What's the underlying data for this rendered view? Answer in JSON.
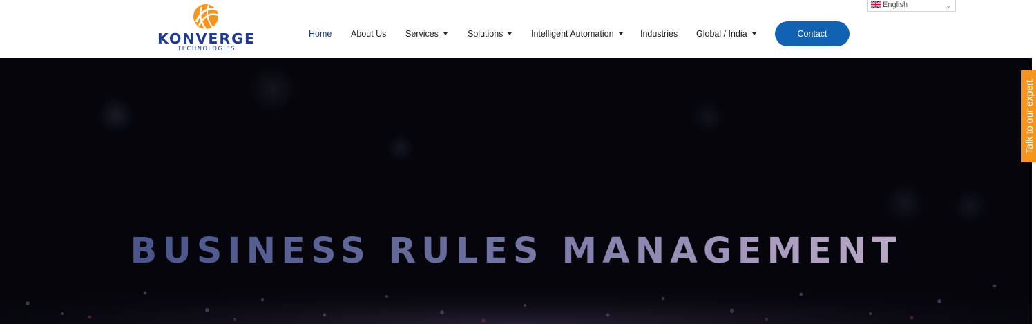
{
  "brand": {
    "name": "KONVERGE",
    "tagline": "TECHNOLOGIES",
    "logo_icon": "globe-swoosh-icon",
    "colors": {
      "primary": "#1d3a8f",
      "accent": "#f7941d"
    }
  },
  "nav": {
    "items": [
      {
        "label": "Home",
        "active": true,
        "dropdown": false
      },
      {
        "label": "About Us",
        "active": false,
        "dropdown": false
      },
      {
        "label": "Services",
        "active": false,
        "dropdown": true
      },
      {
        "label": "Solutions",
        "active": false,
        "dropdown": true
      },
      {
        "label": "Intelligent Automation",
        "active": false,
        "dropdown": true
      },
      {
        "label": "Industries",
        "active": false,
        "dropdown": false
      },
      {
        "label": "Global / India",
        "active": false,
        "dropdown": true
      }
    ],
    "contact_label": "Contact",
    "contact_color": "#1262b3"
  },
  "language": {
    "selected": "English",
    "flag_icon": "uk-flag-icon"
  },
  "hero": {
    "title": "BUSINESS RULES MANAGEMENT"
  },
  "side_tab": {
    "label": "Talk to our expert",
    "color": "#f7941d"
  }
}
